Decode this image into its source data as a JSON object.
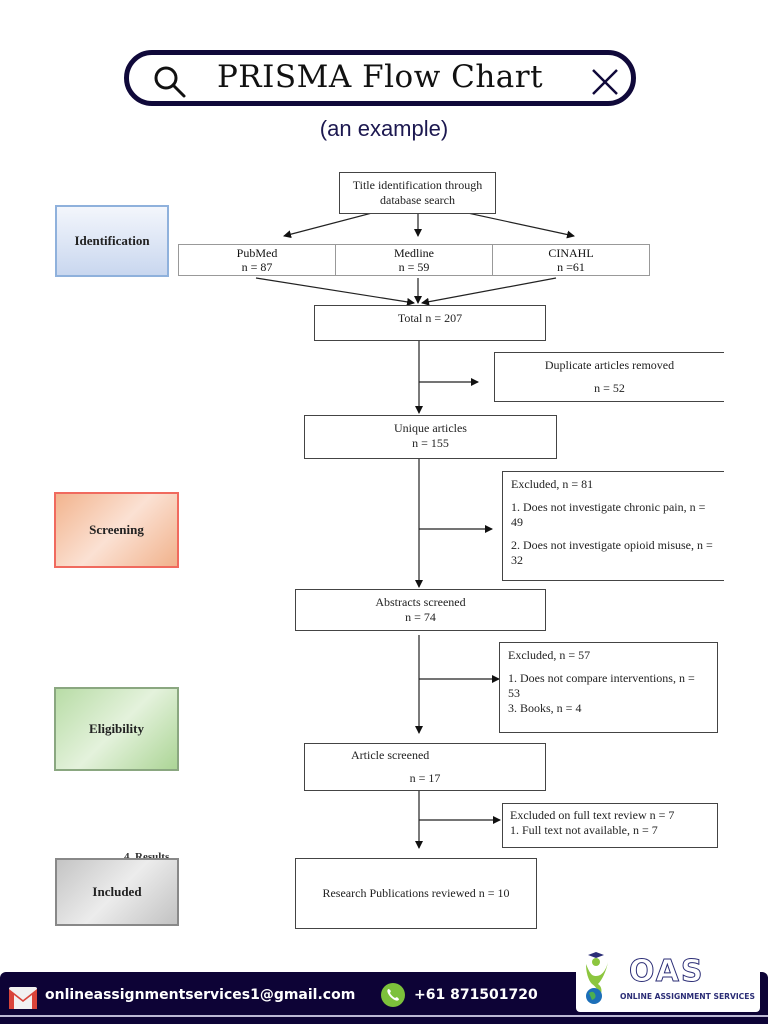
{
  "header": {
    "title": "PRISMA Flow Chart",
    "subtitle": "(an example)",
    "search_icon": "search-icon",
    "close_icon": "close-icon"
  },
  "stages": {
    "identification": "Identification",
    "screening": "Screening",
    "eligibility": "Eligibility",
    "included": "Included",
    "results_partial": "4. Results"
  },
  "flow": {
    "title_box": {
      "line1": "Title identification through",
      "line2": "database search"
    },
    "databases": [
      {
        "name": "PubMed",
        "count": "n = 87"
      },
      {
        "name": "Medline",
        "count": "n = 59"
      },
      {
        "name": "CINAHL",
        "count": "n =61"
      }
    ],
    "total": "Total n = 207",
    "duplicates": {
      "label": "Duplicate articles removed",
      "count": "n = 52"
    },
    "unique": {
      "label": "Unique articles",
      "count": "n = 155"
    },
    "excluded_screening": {
      "header": "Excluded, n = 81",
      "items": [
        "1. Does not investigate chronic pain, n = 49",
        "2. Does not investigate opioid misuse, n = 32"
      ]
    },
    "abstracts": {
      "label": "Abstracts screened",
      "count": "n = 74"
    },
    "excluded_eligibility": {
      "header": "Excluded, n = 57",
      "items": [
        "1. Does not compare interventions, n = 53",
        "3. Books, n = 4"
      ]
    },
    "articles": {
      "label": "Article screened",
      "count": "n = 17"
    },
    "excluded_fulltext": {
      "header": "Excluded on full text review n = 7",
      "items": [
        "1. Full text not available, n = 7"
      ]
    },
    "final": "Research Publications reviewed n = 10"
  },
  "footer": {
    "email": "onlineassignmentservices1@gmail.com",
    "phone": "+61 871501720",
    "mail_icon": "mail-icon",
    "phone_icon": "phone-icon",
    "logo_text": "OAS",
    "logo_subtext": "ONLINE ASSIGNMENT SERVICES",
    "colors": {
      "bar": "#0d0336",
      "phone_badge": "#7cc13b",
      "logo": "#2b2d76"
    }
  }
}
